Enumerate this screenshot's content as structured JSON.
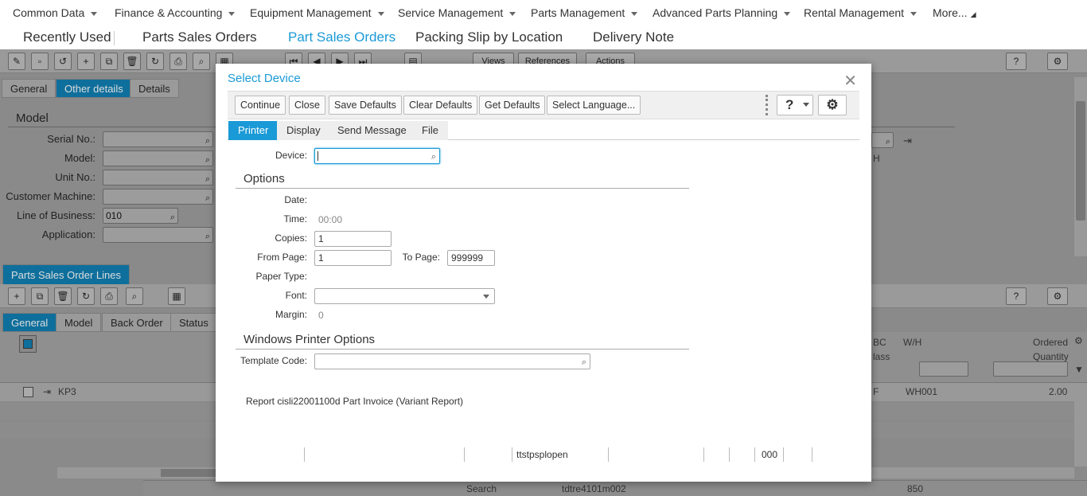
{
  "menu": {
    "items": [
      "Common Data",
      "Finance & Accounting",
      "Equipment Management",
      "Service Management",
      "Parts Management",
      "Advanced Parts Planning",
      "Rental Management",
      "More..."
    ]
  },
  "tabs": {
    "recent": "Recently Used",
    "t1": "Parts Sales Orders",
    "t2": "Part Sales Orders",
    "t3": "Packing Slip by Location",
    "t4": "Delivery Note"
  },
  "bg": {
    "toolbar_buttons": [
      "Views",
      "References",
      "Actions"
    ],
    "subtabs": [
      "General",
      "Other details",
      "Details"
    ],
    "model_section": "Model",
    "fields": [
      {
        "label": "Serial No.:",
        "value": ""
      },
      {
        "label": "Model:",
        "value": ""
      },
      {
        "label": "Unit No.:",
        "value": ""
      },
      {
        "label": "Customer Machine:",
        "value": ""
      },
      {
        "label": "Line of Business:",
        "value": "010"
      },
      {
        "label": "Application:",
        "value": ""
      }
    ],
    "right_field_text": "H",
    "lines_title": "Parts Sales Order Lines",
    "line_tabs": [
      "General",
      "Model",
      "Back Order",
      "Status"
    ],
    "col_bc": "BC",
    "col_class": "lass",
    "col_wh": "W/H",
    "col_ordered": "Ordered",
    "col_quantity": "Quantity",
    "row_item": "KP3",
    "row_wh": "WH001",
    "row_qty": "2.00",
    "row_f": "F",
    "status_search": "Search",
    "status_session": "tdtre4101m002",
    "status_num": "850"
  },
  "dialog": {
    "title": "Select Device",
    "buttons": [
      "Continue",
      "Close",
      "Save Defaults",
      "Clear Defaults",
      "Get Defaults",
      "Select Language..."
    ],
    "tabs": [
      "Printer",
      "Display",
      "Send Message",
      "File"
    ],
    "device_label": "Device:",
    "device_value": "",
    "options_section": "Options",
    "date_label": "Date:",
    "time_label": "Time:",
    "time_value": "00:00",
    "copies_label": "Copies:",
    "copies_value": "1",
    "from_page_label": "From Page:",
    "from_page_value": "1",
    "to_page_label": "To Page:",
    "to_page_value": "999999",
    "paper_type_label": "Paper Type:",
    "font_label": "Font:",
    "font_value": "",
    "margin_label": "Margin:",
    "margin_value": "0",
    "win_section": "Windows Printer Options",
    "template_label": "Template Code:",
    "template_value": "",
    "report_text": "Report cisli22001100d Part Invoice (Variant Report)",
    "status_program": "ttstpsplopen",
    "status_code": "000"
  },
  "colors": {
    "accent": "#1a9ad6",
    "overlay": "#8a8a8a"
  }
}
